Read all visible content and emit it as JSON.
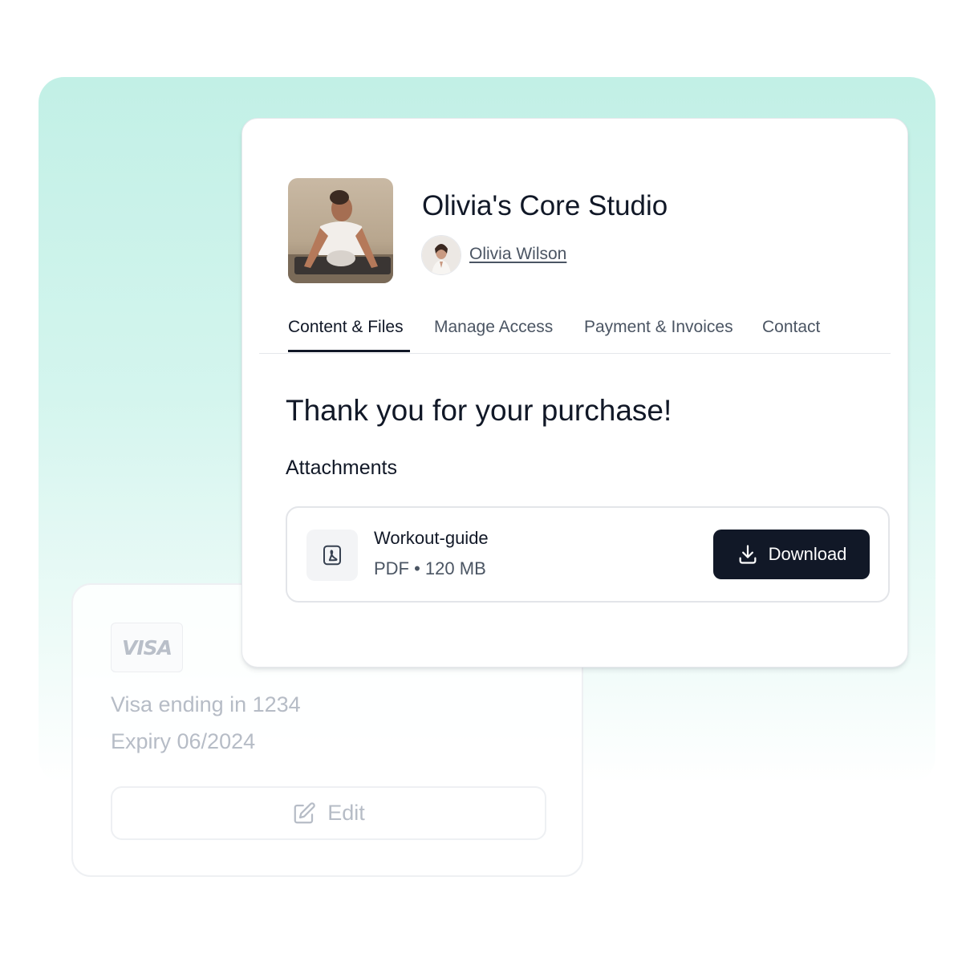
{
  "studio": {
    "title": "Olivia's Core Studio",
    "owner_name": "Olivia Wilson"
  },
  "tabs": [
    {
      "label": "Content & Files",
      "active": true
    },
    {
      "label": "Manage Access",
      "active": false
    },
    {
      "label": "Payment & Invoices",
      "active": false
    },
    {
      "label": "Contact",
      "active": false
    }
  ],
  "content": {
    "heading": "Thank you for your purchase!",
    "attachments_label": "Attachments",
    "attachment": {
      "name": "Workout-guide",
      "meta": "PDF • 120 MB",
      "icon": "pdf-file-icon",
      "download_label": "Download"
    }
  },
  "payment": {
    "brand": "VISA",
    "card_line": "Visa ending in 1234",
    "expiry_line": "Expiry 06/2024",
    "edit_label": "Edit"
  },
  "colors": {
    "accent_dark": "#111827",
    "backdrop_mint": "#c2f0e6",
    "muted_text": "#b6bcc6"
  }
}
